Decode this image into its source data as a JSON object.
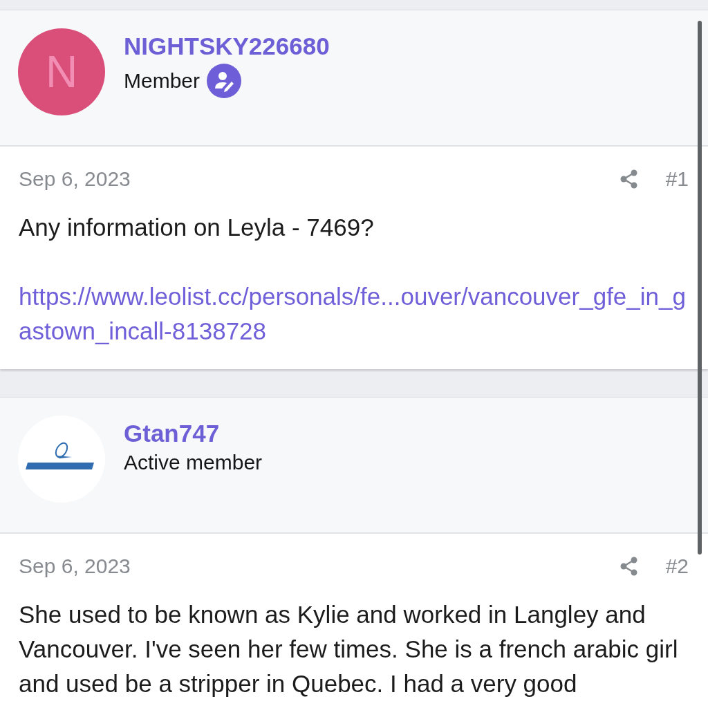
{
  "posts": [
    {
      "author": {
        "name": "NIGHTSKY226680",
        "role": "Member",
        "avatar": {
          "kind": "letter",
          "letter": "N"
        },
        "staff_badge": true
      },
      "date": "Sep 6, 2023",
      "number": "#1",
      "content": [
        {
          "kind": "text",
          "text": "Any information on Leyla - 7469?"
        },
        {
          "kind": "link",
          "text": "https://www.leolist.cc/personals/fe...ouver/vancouver_gfe_in_gastown_incall-8138728"
        }
      ]
    },
    {
      "author": {
        "name": "Gtan747",
        "role": "Active member",
        "staff_badge": false
      },
      "date": "Sep 6, 2023",
      "number": "#2",
      "content": [
        {
          "kind": "text",
          "text": "She used to be known as Kylie and worked in Langley and Vancouver. I've seen her few times. She is a french arabic girl and used be a stripper in Quebec. I had a very good"
        }
      ]
    }
  ]
}
